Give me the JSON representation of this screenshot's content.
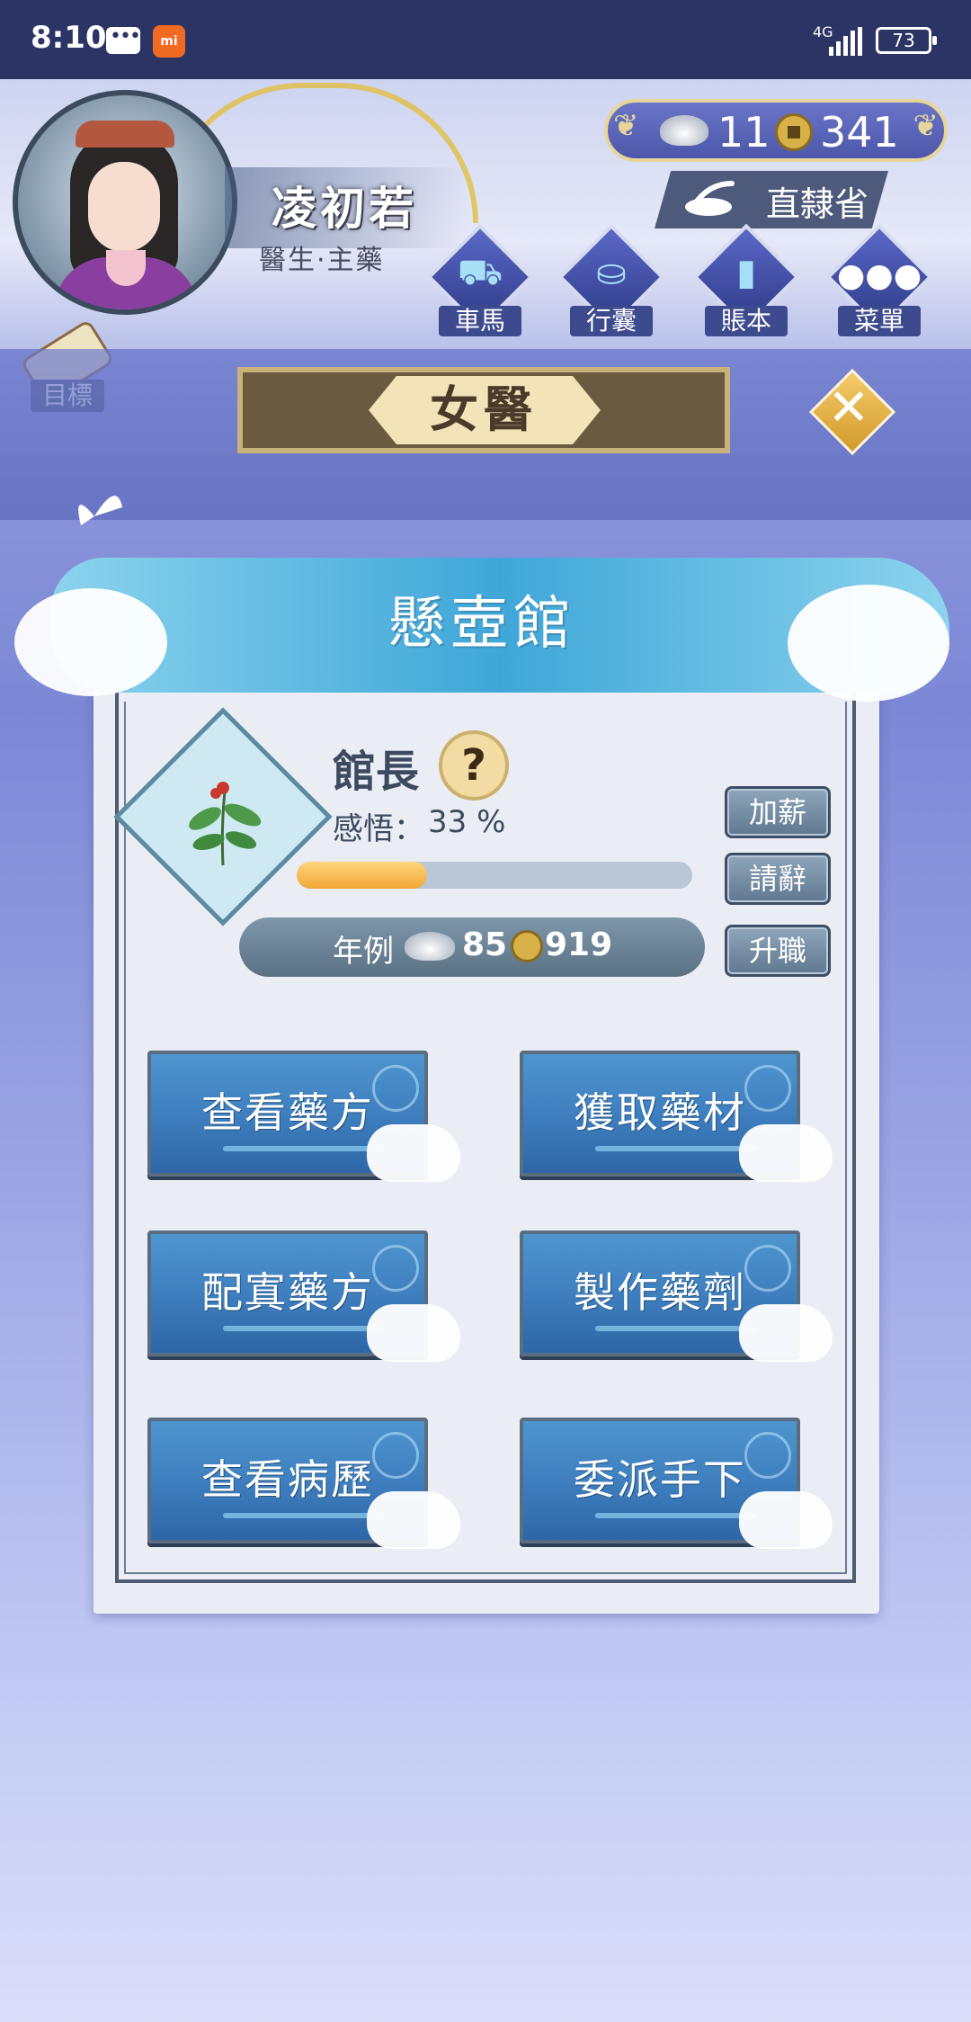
{
  "status_bar": {
    "time": "8:10",
    "network": "4G",
    "battery": "73"
  },
  "character": {
    "name": "凌初若",
    "title": "醫生·主藥"
  },
  "currency": {
    "silver": "11",
    "copper": "341"
  },
  "location": {
    "label": "直隸省"
  },
  "menu": [
    {
      "label": "車馬",
      "icon": "carriage-icon"
    },
    {
      "label": "行囊",
      "icon": "bag-icon"
    },
    {
      "label": "賬本",
      "icon": "ledger-icon"
    },
    {
      "label": "菜單",
      "icon": "more-icon"
    }
  ],
  "goal": {
    "label": "目標"
  },
  "title_plate": {
    "text": "女醫"
  },
  "banner": {
    "text": "懸壺館"
  },
  "role": {
    "name": "館長",
    "help_symbol": "?",
    "insight_label": "感悟：",
    "insight_value": "33 %",
    "insight_fraction": 0.33
  },
  "salary": {
    "label": "年例",
    "silver": "85",
    "copper": "919"
  },
  "side_buttons": {
    "raise": "加薪",
    "resign": "請辭",
    "promote": "升職"
  },
  "actions": [
    {
      "label": "查看藥方"
    },
    {
      "label": "獲取藥材"
    },
    {
      "label": "配寘藥方"
    },
    {
      "label": "製作藥劑"
    },
    {
      "label": "查看病歷"
    },
    {
      "label": "委派手下"
    }
  ],
  "colors": {
    "accent_gold": "#e2c044",
    "panel_bg": "#ebedf5",
    "button_blue": "#3f7fbf",
    "progress": "#f2a738"
  }
}
